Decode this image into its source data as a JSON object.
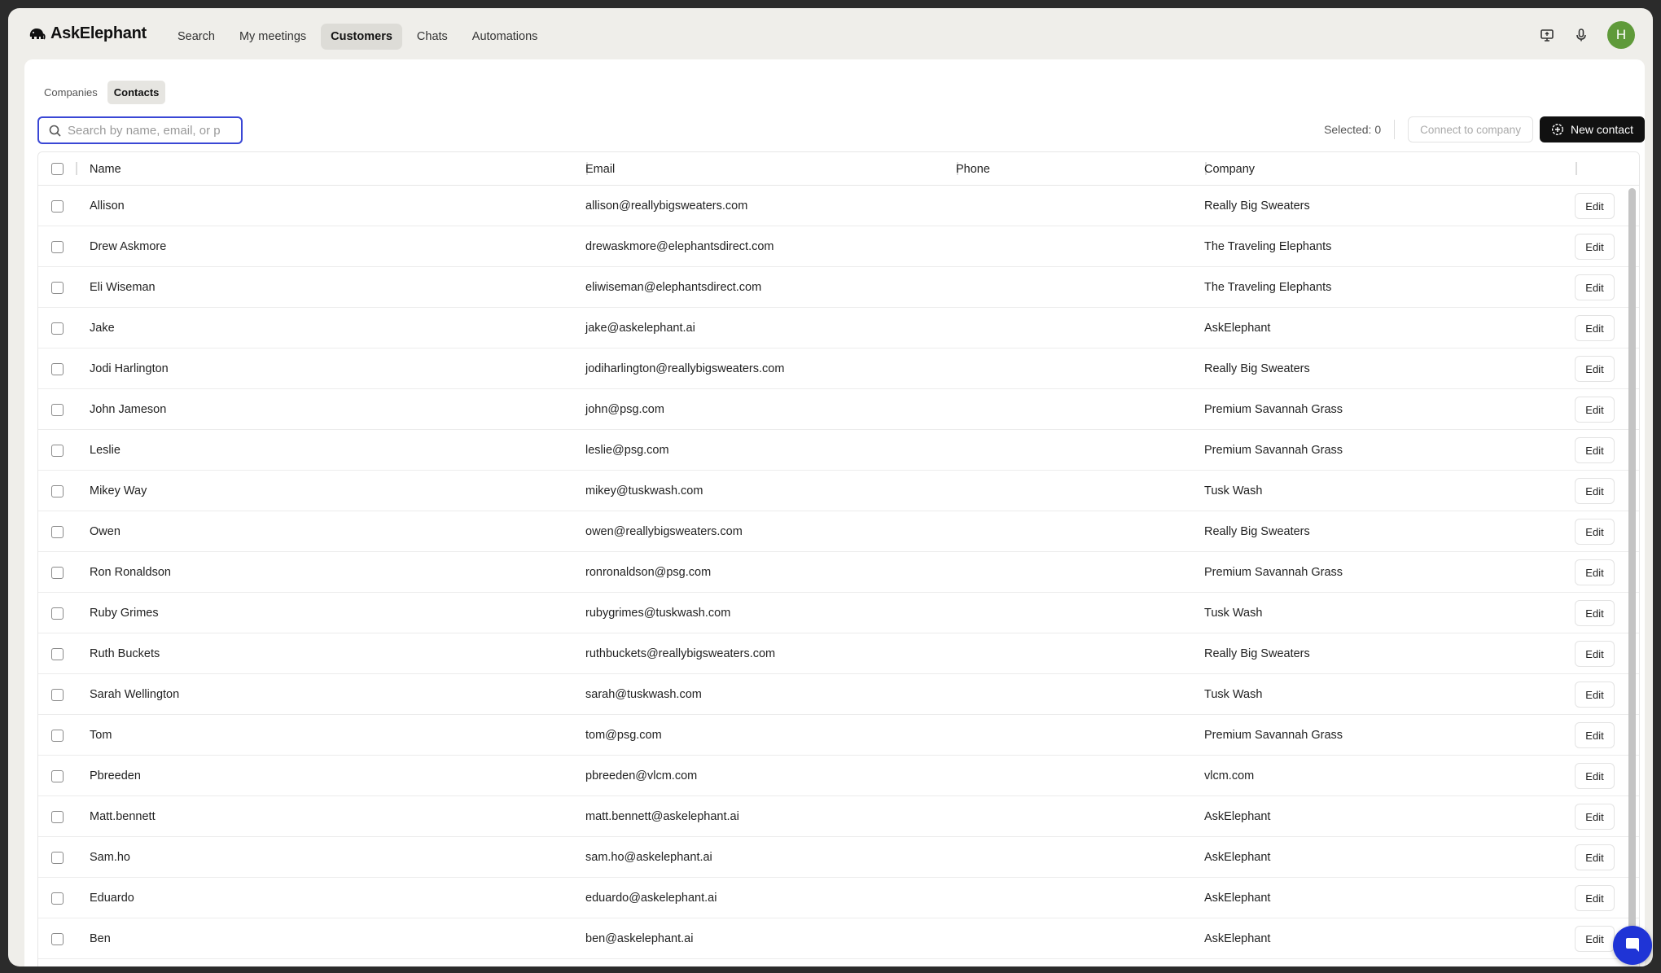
{
  "app": {
    "name": "AskElephant"
  },
  "nav": {
    "items": [
      {
        "label": "Search",
        "active": false
      },
      {
        "label": "My meetings",
        "active": false
      },
      {
        "label": "Customers",
        "active": true
      },
      {
        "label": "Chats",
        "active": false
      },
      {
        "label": "Automations",
        "active": false
      }
    ],
    "avatar_initial": "H"
  },
  "subtabs": [
    {
      "label": "Companies",
      "active": false
    },
    {
      "label": "Contacts",
      "active": true
    }
  ],
  "search": {
    "placeholder": "Search by name, email, or p",
    "value": ""
  },
  "toolbar": {
    "selected_label": "Selected: 0",
    "connect_label": "Connect to company",
    "new_contact_label": "New contact"
  },
  "table": {
    "columns": [
      "Name",
      "Email",
      "Phone",
      "Company"
    ],
    "edit_label": "Edit",
    "rows": [
      {
        "name": "Allison",
        "email": "allison@reallybigsweaters.com",
        "phone": "",
        "company": "Really Big Sweaters"
      },
      {
        "name": "Drew Askmore",
        "email": "drewaskmore@elephantsdirect.com",
        "phone": "",
        "company": "The Traveling Elephants"
      },
      {
        "name": "Eli Wiseman",
        "email": "eliwiseman@elephantsdirect.com",
        "phone": "",
        "company": "The Traveling Elephants"
      },
      {
        "name": "Jake",
        "email": "jake@askelephant.ai",
        "phone": "",
        "company": "AskElephant"
      },
      {
        "name": "Jodi Harlington",
        "email": "jodiharlington@reallybigsweaters.com",
        "phone": "",
        "company": "Really Big Sweaters"
      },
      {
        "name": "John Jameson",
        "email": "john@psg.com",
        "phone": "",
        "company": "Premium Savannah Grass"
      },
      {
        "name": "Leslie",
        "email": "leslie@psg.com",
        "phone": "",
        "company": "Premium Savannah Grass"
      },
      {
        "name": "Mikey Way",
        "email": "mikey@tuskwash.com",
        "phone": "",
        "company": "Tusk Wash"
      },
      {
        "name": "Owen",
        "email": "owen@reallybigsweaters.com",
        "phone": "",
        "company": "Really Big Sweaters"
      },
      {
        "name": "Ron Ronaldson",
        "email": "ronronaldson@psg.com",
        "phone": "",
        "company": "Premium Savannah Grass"
      },
      {
        "name": "Ruby Grimes",
        "email": "rubygrimes@tuskwash.com",
        "phone": "",
        "company": "Tusk Wash"
      },
      {
        "name": "Ruth Buckets",
        "email": "ruthbuckets@reallybigsweaters.com",
        "phone": "",
        "company": "Really Big Sweaters"
      },
      {
        "name": "Sarah Wellington",
        "email": "sarah@tuskwash.com",
        "phone": "",
        "company": "Tusk Wash"
      },
      {
        "name": "Tom",
        "email": "tom@psg.com",
        "phone": "",
        "company": "Premium Savannah Grass"
      },
      {
        "name": "Pbreeden",
        "email": "pbreeden@vlcm.com",
        "phone": "",
        "company": "vlcm.com"
      },
      {
        "name": "Matt.bennett",
        "email": "matt.bennett@askelephant.ai",
        "phone": "",
        "company": "AskElephant"
      },
      {
        "name": "Sam.ho",
        "email": "sam.ho@askelephant.ai",
        "phone": "",
        "company": "AskElephant"
      },
      {
        "name": "Eduardo",
        "email": "eduardo@askelephant.ai",
        "phone": "",
        "company": "AskElephant"
      },
      {
        "name": "Ben",
        "email": "ben@askelephant.ai",
        "phone": "",
        "company": "AskElephant"
      }
    ]
  },
  "icons": {
    "logo": "elephant-logo-icon",
    "screen": "screen-share-icon",
    "mic": "microphone-icon",
    "search": "search-icon",
    "new_contact": "add-contact-icon",
    "chat": "chat-bubble-icon"
  },
  "colors": {
    "accent": "#3a47d5",
    "chat_button": "#1f34d6",
    "avatar": "#5f9a3a",
    "primary_button": "#111111"
  }
}
